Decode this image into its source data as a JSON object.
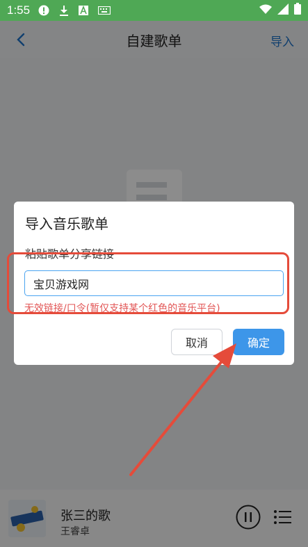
{
  "status_bar": {
    "time": "1:55",
    "icons_left": [
      "alert-icon",
      "download-icon",
      "a-icon",
      "keyboard-icon"
    ],
    "icons_right": [
      "wifi-icon",
      "signal-icon",
      "battery-icon"
    ]
  },
  "header": {
    "title": "自建歌单",
    "import_label": "导入"
  },
  "player": {
    "song_title": "张三的歌",
    "artist": "王睿卓"
  },
  "dialog": {
    "title": "导入音乐歌单",
    "label": "粘贴歌单分享链接",
    "input_value": "宝贝游戏网",
    "error_text": "无效链接/口令(暂仅支持某个红色的音乐平台)",
    "cancel_label": "取消",
    "confirm_label": "确定"
  },
  "colors": {
    "status_bar": "#4fa855",
    "accent": "#3d96e9",
    "error": "#e25555",
    "annotation": "#e54b3a"
  }
}
